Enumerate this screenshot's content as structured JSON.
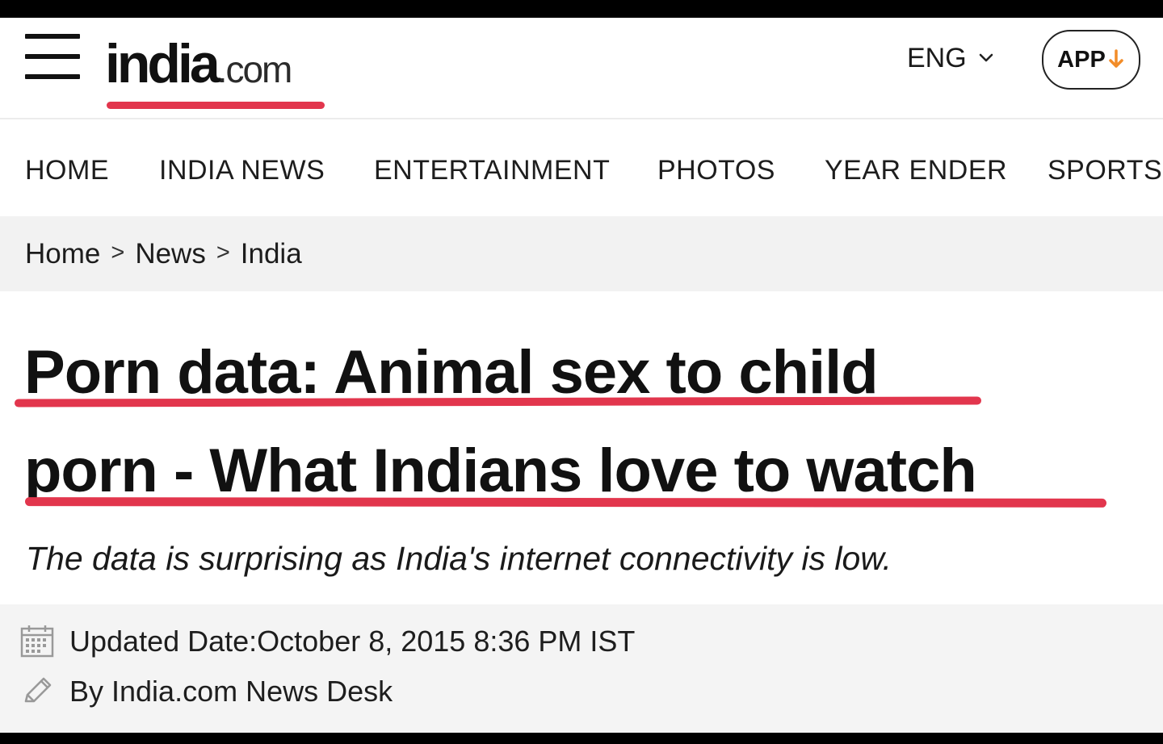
{
  "header": {
    "logo_word": "india",
    "logo_domain": ".com",
    "language_label": "ENG",
    "app_label": "APP"
  },
  "nav": {
    "items": [
      {
        "label": "HOME"
      },
      {
        "label": "INDIA NEWS"
      },
      {
        "label": "ENTERTAINMENT"
      },
      {
        "label": "PHOTOS"
      },
      {
        "label": "YEAR ENDER"
      },
      {
        "label": "SPORTS"
      }
    ]
  },
  "breadcrumb": {
    "items": [
      "Home",
      "News",
      "India"
    ],
    "separator": ">"
  },
  "article": {
    "title_line_1": "Porn data: Animal sex to child",
    "title_line_2": "porn - What Indians love to watch",
    "subtitle": "The data is surprising as India's internet connectivity is low.",
    "updated": "Updated Date:October 8, 2015 8:36 PM IST",
    "byline": "By India.com News Desk"
  },
  "icons": {
    "menu": "hamburger-menu-icon",
    "language": "chevron-down-icon",
    "app": "download-arrow-icon",
    "date": "calendar-icon",
    "author": "pencil-icon"
  },
  "colors": {
    "accent": "#e2364d",
    "download_arrow": "#f28c28",
    "page_bg": "#ffffff",
    "gray_band": "#f2f2f2",
    "dark_text": "#111111"
  }
}
